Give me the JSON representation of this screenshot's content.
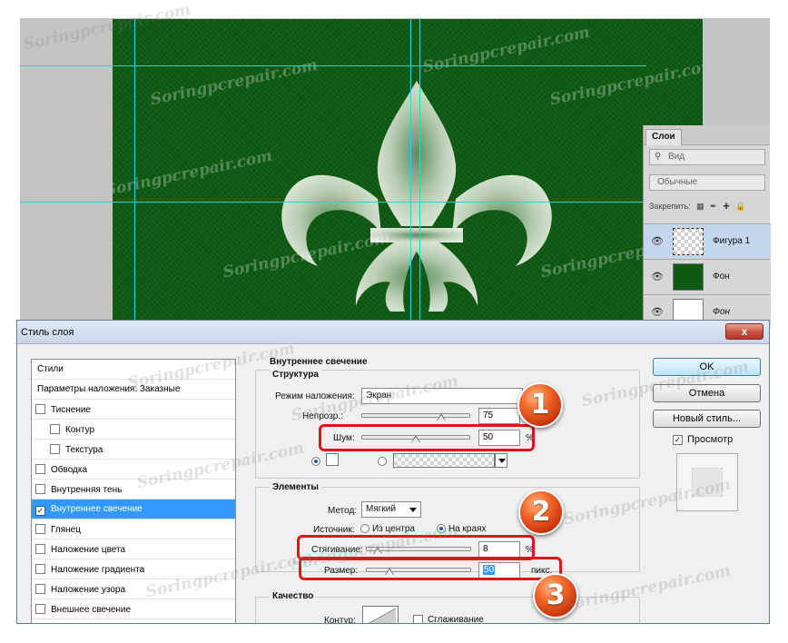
{
  "watermark": "Soringpcrepair.com",
  "layers_panel": {
    "tab_label": "Слои",
    "filter_label": "Вид",
    "blend_mode": "Обычные",
    "lock_label": "Закрепить:",
    "layers": [
      {
        "name": "Фигура 1",
        "selected": true,
        "italic": false
      },
      {
        "name": "Фон",
        "selected": false,
        "italic": false
      },
      {
        "name": "Фон",
        "selected": false,
        "italic": true
      }
    ]
  },
  "dialog": {
    "title": "Стиль слоя",
    "close_glyph": "x",
    "styles_list": {
      "header_styles": "Стили",
      "header_blending": "Параметры наложения: Заказные",
      "items": [
        {
          "label": "Тиснение",
          "checked": false,
          "indent": false,
          "selected": false
        },
        {
          "label": "Контур",
          "checked": false,
          "indent": true,
          "selected": false
        },
        {
          "label": "Текстура",
          "checked": false,
          "indent": true,
          "selected": false
        },
        {
          "label": "Обводка",
          "checked": false,
          "indent": false,
          "selected": false
        },
        {
          "label": "Внутренняя тень",
          "checked": false,
          "indent": false,
          "selected": false
        },
        {
          "label": "Внутреннее свечение",
          "checked": true,
          "indent": false,
          "selected": true
        },
        {
          "label": "Глянец",
          "checked": false,
          "indent": false,
          "selected": false
        },
        {
          "label": "Наложение цвета",
          "checked": false,
          "indent": false,
          "selected": false
        },
        {
          "label": "Наложение градиента",
          "checked": false,
          "indent": false,
          "selected": false
        },
        {
          "label": "Наложение узора",
          "checked": false,
          "indent": false,
          "selected": false
        },
        {
          "label": "Внешнее свечение",
          "checked": false,
          "indent": false,
          "selected": false
        }
      ]
    },
    "settings": {
      "section_title": "Внутреннее свечение",
      "structure_title": "Структура",
      "blend_mode_label": "Режим наложения:",
      "blend_mode_value": "Экран",
      "opacity_label": "Непрозр.:",
      "opacity_value": "75",
      "opacity_pct": 75,
      "noise_label": "Шум:",
      "noise_value": "50",
      "noise_pct": 50,
      "unit_percent": "%",
      "elements_title": "Элементы",
      "method_label": "Метод:",
      "method_value": "Мягкий",
      "source_label": "Источник:",
      "source_center": "Из центра",
      "source_edge": "На краях",
      "choke_label": "Стягивание:",
      "choke_value": "8",
      "choke_pct": 8,
      "size_label": "Размер:",
      "size_value": "50",
      "size_pct": 20,
      "unit_pixels": "пикс.",
      "quality_title": "Качество",
      "contour_label": "Контур:",
      "antialias_label": "Сглаживание"
    },
    "buttons": {
      "ok": "OK",
      "cancel": "Отмена",
      "new_style": "Новый стиль...",
      "preview_label": "Просмотр",
      "preview_checked": true
    }
  },
  "callouts": [
    "1",
    "2",
    "3"
  ],
  "colors": {
    "canvas_green": "#0e5a12",
    "guide_cyan": "#33d0d0",
    "highlight_red": "#e0141a",
    "selection_blue": "#3399ff",
    "callout_orange": "#e8541a"
  }
}
